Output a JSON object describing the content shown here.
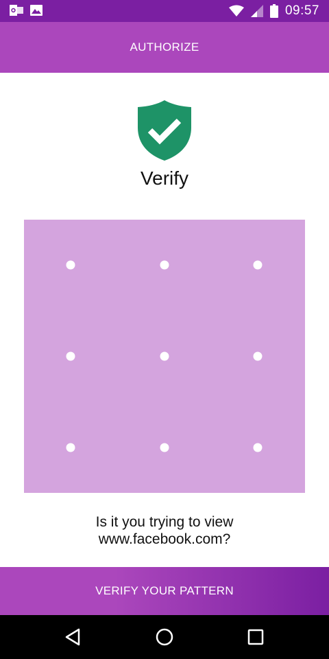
{
  "status_bar": {
    "time": "09:57",
    "left_icons": [
      "outlook-icon",
      "image-icon"
    ],
    "right_icons": [
      "wifi-icon",
      "cell-signal-icon",
      "battery-icon"
    ]
  },
  "app_bar": {
    "title": "AUTHORIZE"
  },
  "verify": {
    "icon": "shield-check-icon",
    "title": "Verify"
  },
  "pattern": {
    "rows": 3,
    "cols": 3
  },
  "message": {
    "line1": "Is it you trying to view",
    "line2": "www.facebook.com?"
  },
  "actions": {
    "verify_label": "VERIFY YOUR PATTERN"
  },
  "nav_bar": {
    "buttons": [
      "back-icon",
      "home-icon",
      "recents-icon"
    ]
  },
  "colors": {
    "status_bar": "#7b1fa2",
    "app_bar": "#ab47bc",
    "pattern_bg": "#d4a4de",
    "shield": "#1e9367"
  }
}
